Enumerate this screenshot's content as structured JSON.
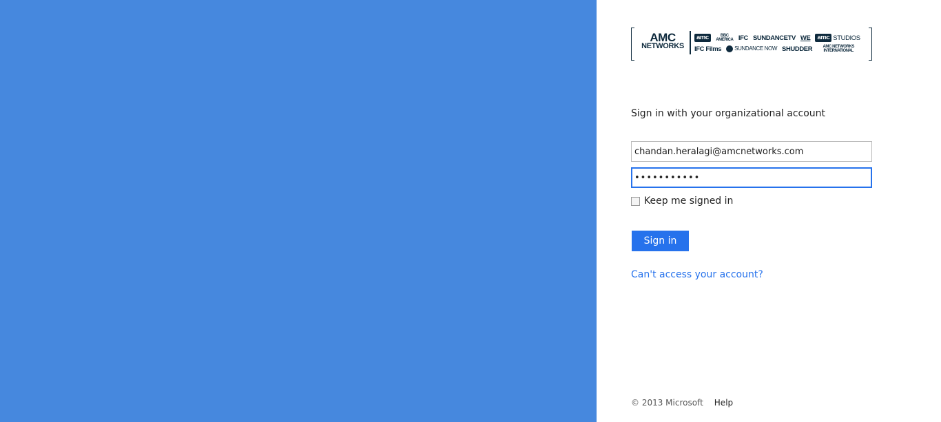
{
  "logo": {
    "main_line1": "AMC",
    "main_line2": "NETWORKS",
    "row1": [
      "amc",
      "BBC AMERICA",
      "IFC",
      "SUNDANCETV",
      "WE",
      "amc",
      "STUDIOS"
    ],
    "row2": [
      "IFC Films",
      "SUNDANCE NOW",
      "SHUDDER",
      "AMC NETWORKS INTERNATIONAL"
    ]
  },
  "form": {
    "heading": "Sign in with your organizational account",
    "email_value": "chandan.heralagi@amcnetworks.com",
    "password_value": "•••••••••••",
    "keep_signed_in_label": "Keep me signed in",
    "keep_signed_in_checked": false,
    "signin_label": "Sign in",
    "cant_access_label": "Can't access your account?"
  },
  "footer": {
    "copyright": "© 2013 Microsoft",
    "help": "Help"
  },
  "colors": {
    "illustration_bg": "#4688de",
    "accent": "#2672ec",
    "logo_navy": "#0e2a3d"
  }
}
